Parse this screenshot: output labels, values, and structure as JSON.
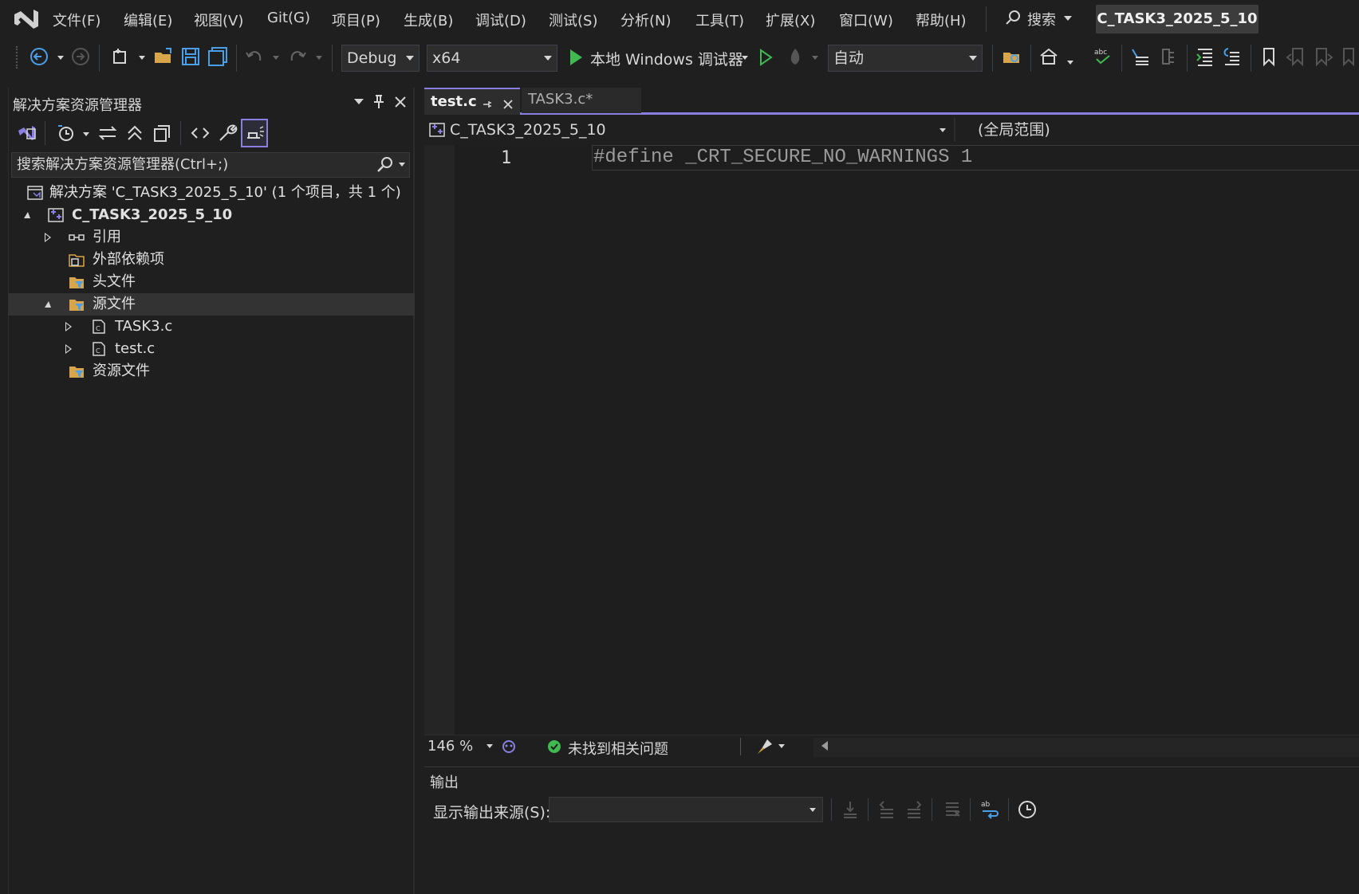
{
  "menu": {
    "items": [
      "文件(F)",
      "编辑(E)",
      "视图(V)",
      "Git(G)",
      "项目(P)",
      "生成(B)",
      "调试(D)",
      "测试(S)",
      "分析(N)",
      "工具(T)",
      "扩展(X)",
      "窗口(W)",
      "帮助(H)"
    ],
    "search_label": "搜索",
    "project_title": "C_TASK3_2025_5_10"
  },
  "toolbar": {
    "config": "Debug",
    "platform": "x64",
    "run_label": "本地 Windows 调试器",
    "auto": "自动"
  },
  "solution_explorer": {
    "title": "解决方案资源管理器",
    "search_placeholder": "搜索解决方案资源管理器(Ctrl+;)",
    "tree": [
      {
        "label": "解决方案 'C_TASK3_2025_5_10' (1 个项目，共 1 个)",
        "bold": false
      },
      {
        "label": "C_TASK3_2025_5_10",
        "bold": true
      },
      {
        "label": "引用"
      },
      {
        "label": "外部依赖项"
      },
      {
        "label": "头文件"
      },
      {
        "label": "源文件"
      },
      {
        "label": "TASK3.c"
      },
      {
        "label": "test.c"
      },
      {
        "label": "资源文件"
      }
    ]
  },
  "editor": {
    "tabs": [
      {
        "label": "test.c",
        "active": true
      },
      {
        "label": "TASK3.c*",
        "active": false
      }
    ],
    "nav_project": "C_TASK3_2025_5_10",
    "nav_scope": "(全局范围)",
    "line_number": "1",
    "code_line": "#define _CRT_SECURE_NO_WARNINGS 1",
    "zoom": "146 %",
    "issues": "未找到相关问题"
  },
  "output": {
    "title": "输出",
    "source_label": "显示输出来源(S):"
  },
  "colors": {
    "accent": "#8a7ee0",
    "run_green": "#3fb950",
    "ok_green": "#3fb950"
  }
}
